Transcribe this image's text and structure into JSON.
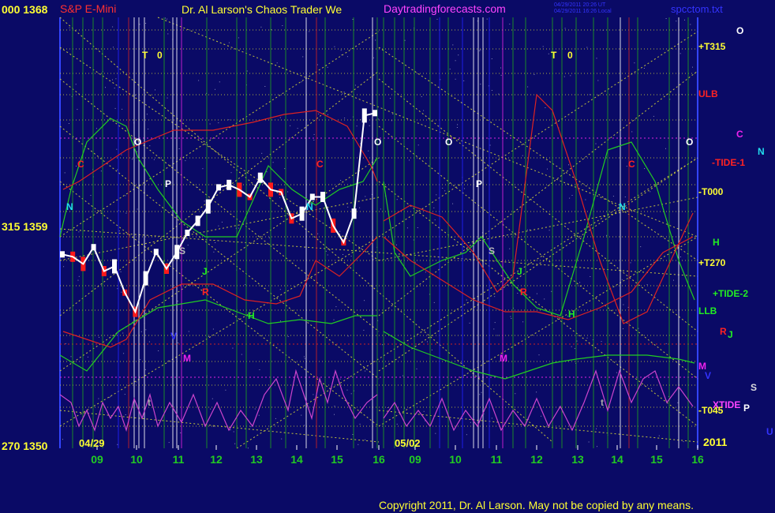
{
  "header": {
    "price_label_top": "000  1368",
    "instrument": "S&P E-Mini",
    "title": "Dr. Al Larson's Chaos Trader We",
    "site": "Daytradingforecasts.com",
    "timestamp_line1": "04/29/2011 20:26 UT",
    "timestamp_line2": "04/29/2011 16:26 Local",
    "file": "spcctom.txt"
  },
  "left_axis": {
    "mid_label": "315  1359",
    "bottom_label": "270  1350"
  },
  "date_labels": {
    "first": "04/29",
    "second": "05/02",
    "year": "2011"
  },
  "copyright": "Copyright 2011, Dr. Al Larson. May not be copied by any means.",
  "colors": {
    "background": "#0a0a66",
    "vertical_green": "#1f9f1f",
    "vertical_red": "#cc2222",
    "vertical_white": "#ffffff",
    "vertical_magenta": "#dd22dd",
    "vertical_blue": "#2222ff",
    "diagonal_yellow": "#d8d838",
    "price_up": "#ffffff",
    "price_down": "#ff1a1a",
    "tide_green": "#22cc22",
    "tide_red": "#dd2222",
    "xtide_magenta": "#cc44cc"
  },
  "chart_data": {
    "type": "line",
    "title": "S&P E-Mini",
    "xlabel": "",
    "ylabel": "",
    "ylim": [
      1350,
      1368
    ],
    "x_ticks": [
      "09",
      "10",
      "11",
      "12",
      "13",
      "14",
      "15",
      "16",
      "09",
      "10",
      "11",
      "12",
      "13",
      "14",
      "15",
      "16"
    ],
    "y_ticks": [
      {
        "label": "000  1368",
        "value": 1368
      },
      {
        "label": "315  1359",
        "value": 1359
      },
      {
        "label": "270  1350",
        "value": 1350
      }
    ],
    "series": [
      {
        "name": "",
        "values": [
          1358.1,
          1358.0,
          1357.7,
          1358.4,
          1357.4,
          1357.6,
          1356.5,
          1355.7,
          1357.1,
          1358.2,
          1357.5,
          1358.2,
          1359.0,
          1359.5,
          1360.1,
          1360.9,
          1361.0,
          1360.8,
          1360.5,
          1361.3,
          1360.8,
          1360.7,
          1359.6,
          1359.8,
          1360.5,
          1360.5,
          1359.3,
          1358.6,
          1359.8,
          1363.9,
          1364.0
        ]
      }
    ],
    "right_level_labels": [
      {
        "label": "+T315",
        "color": "#ffff33"
      },
      {
        "label": "ULB",
        "color": "#ff2222"
      },
      {
        "label": "-TIDE-1",
        "color": "#ff2222"
      },
      {
        "label": "-T000",
        "color": "#ffff33"
      },
      {
        "label": "H",
        "color": "#22ee22"
      },
      {
        "label": "+T270",
        "color": "#ffff33"
      },
      {
        "label": "+TIDE-2",
        "color": "#22ee22"
      },
      {
        "label": "LLB",
        "color": "#22ee22"
      },
      {
        "label": "M",
        "color": "#ee22ee"
      },
      {
        "label": "XTIDE",
        "color": "#ff44ff"
      },
      {
        "label": "-T045",
        "color": "#ffff33"
      }
    ],
    "far_right_glyphs": [
      {
        "label": "O",
        "color": "#ffffff"
      },
      {
        "label": "C",
        "color": "#ee22ee"
      },
      {
        "label": "N",
        "color": "#22ddee"
      },
      {
        "label": "R",
        "color": "#ff2222"
      },
      {
        "label": "J",
        "color": "#22ee22"
      },
      {
        "label": "V",
        "color": "#3333ff"
      },
      {
        "label": "S",
        "color": "#dddddd"
      },
      {
        "label": "P",
        "color": "#ffffff"
      },
      {
        "label": "U",
        "color": "#3333ff"
      }
    ],
    "plot_glyphs": [
      {
        "label": "T",
        "color": "#ffff33"
      },
      {
        "label": "0",
        "color": "#ffff33"
      },
      {
        "label": "T",
        "color": "#ffff33"
      },
      {
        "label": "0",
        "color": "#ffff33"
      },
      {
        "label": "O",
        "color": "#ffffff"
      },
      {
        "label": "O",
        "color": "#ffffff"
      },
      {
        "label": "O",
        "color": "#ffffff"
      },
      {
        "label": "O",
        "color": "#ffffff"
      },
      {
        "label": "C",
        "color": "#ff2222"
      },
      {
        "label": "C",
        "color": "#ff2222"
      },
      {
        "label": "C",
        "color": "#ff2222"
      },
      {
        "label": "N",
        "color": "#22ddee"
      },
      {
        "label": "N",
        "color": "#22ddee"
      },
      {
        "label": "N",
        "color": "#22ddee"
      },
      {
        "label": "P",
        "color": "#ffffff"
      },
      {
        "label": "P",
        "color": "#ffffff"
      },
      {
        "label": "S",
        "color": "#bbbbbb"
      },
      {
        "label": "S",
        "color": "#bbbbbb"
      },
      {
        "label": "J",
        "color": "#22ee22"
      },
      {
        "label": "J",
        "color": "#22ee22"
      },
      {
        "label": "R",
        "color": "#ff2222"
      },
      {
        "label": "R",
        "color": "#ff2222"
      },
      {
        "label": "H",
        "color": "#22ee22"
      },
      {
        "label": "H",
        "color": "#22ee22"
      },
      {
        "label": "V",
        "color": "#3333ff"
      },
      {
        "label": "M",
        "color": "#ee22ee"
      },
      {
        "label": "M",
        "color": "#ee22ee"
      },
      {
        "label": "t",
        "color": "#aaaaaa"
      },
      {
        "label": "t",
        "color": "#aaaaaa"
      }
    ]
  }
}
